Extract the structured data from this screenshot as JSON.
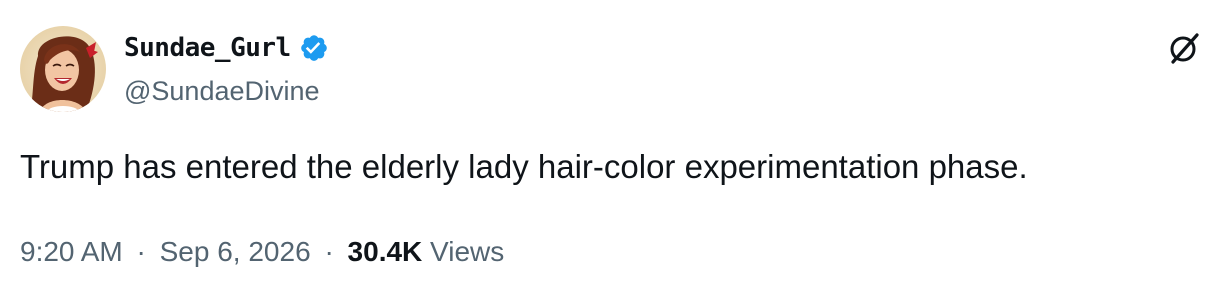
{
  "tweet": {
    "author": {
      "display_name": "Sundae_Gurl",
      "handle": "@SundaeDivine",
      "verified": true,
      "avatar_icon": "avatar-portrait-woman-laughing"
    },
    "text": "Trump has entered the elderly lady hair-color experimentation phase.",
    "time": "9:20 AM",
    "separator": "·",
    "date": "Sep 6, 2026",
    "views_count": "30.4K",
    "views_label": "Views"
  },
  "icons": {
    "verified_badge": "verified-badge-icon",
    "grok": "grok-icon"
  },
  "colors": {
    "verified_blue": "#1d9bf0",
    "text_primary": "#0f1419",
    "text_secondary": "#536471"
  }
}
